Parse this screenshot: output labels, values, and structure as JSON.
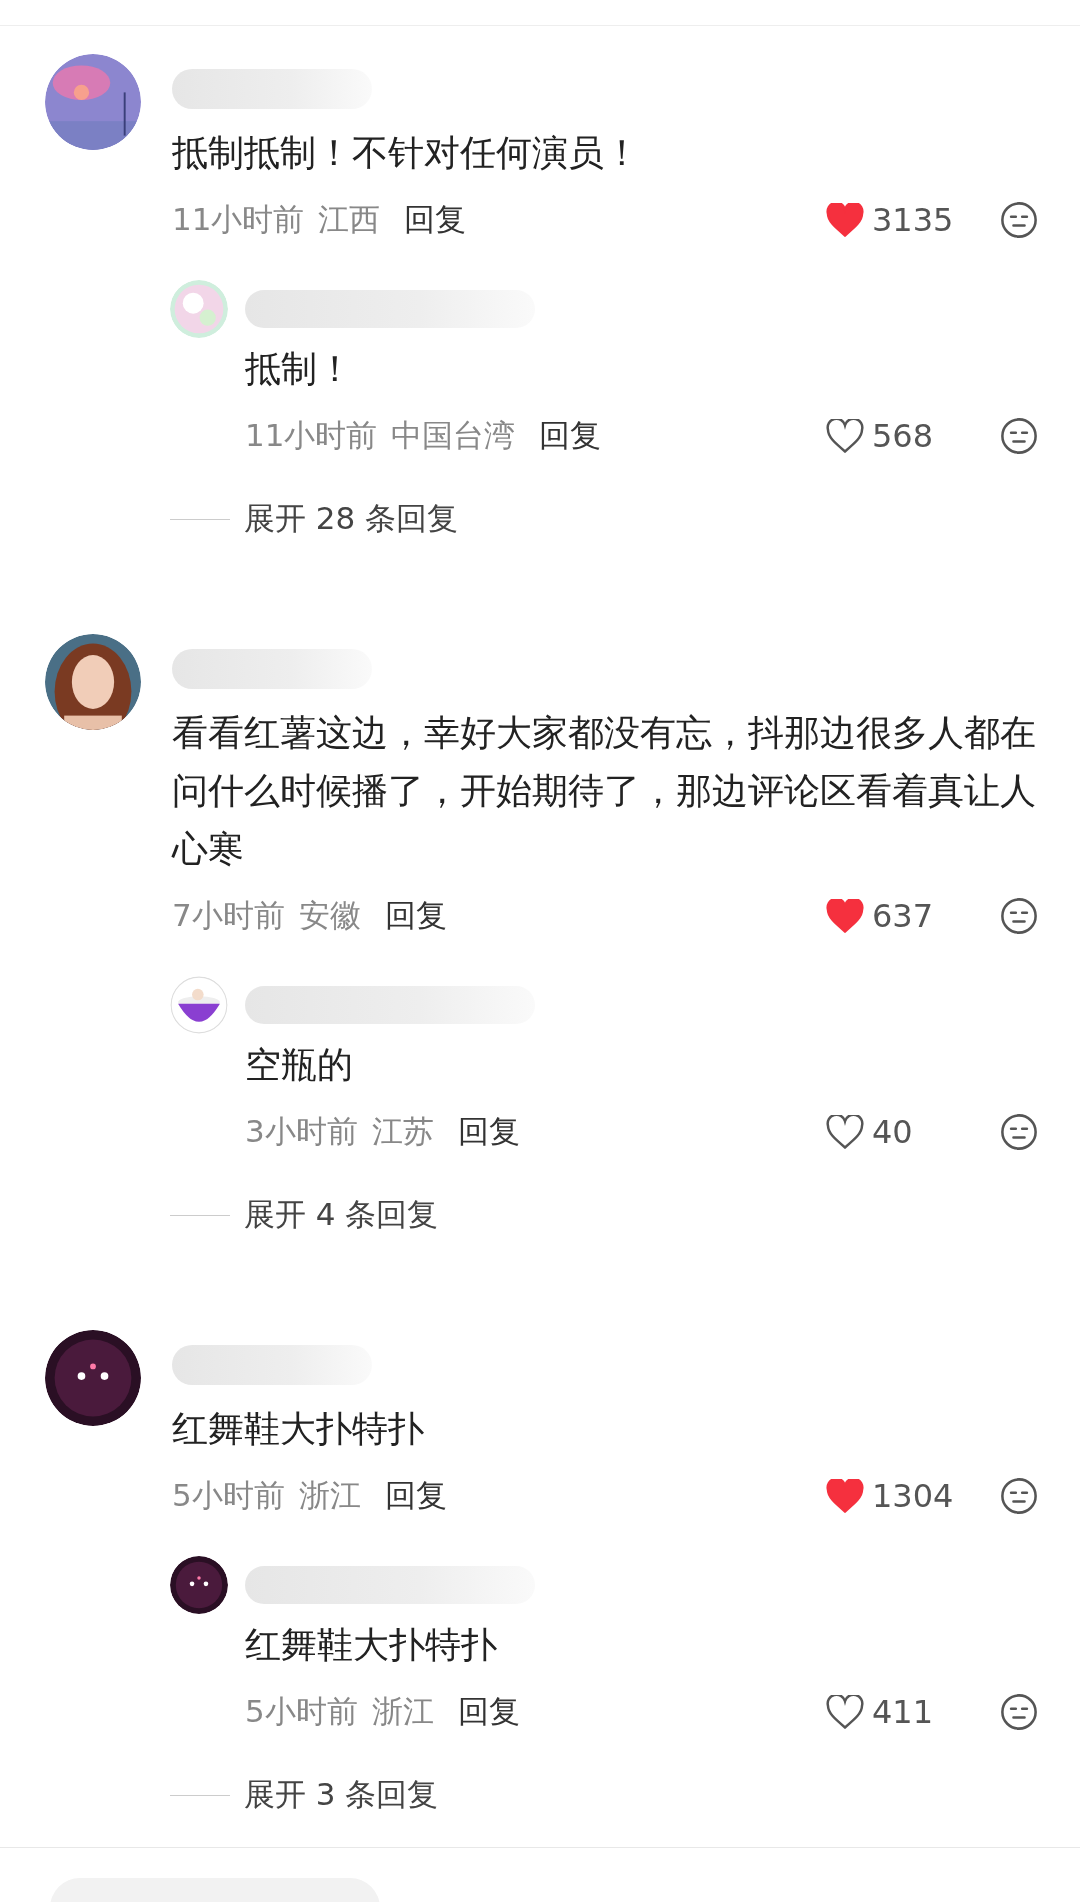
{
  "comments": [
    {
      "text": "抵制抵制！不针对任何演员！",
      "time": "11小时前",
      "location": "江西",
      "reply_label": "回复",
      "likes": "3135",
      "liked": true,
      "replies": [
        {
          "text": "抵制！",
          "time": "11小时前",
          "location": "中国台湾",
          "reply_label": "回复",
          "likes": "568",
          "liked": false
        }
      ],
      "expand": "展开 28 条回复"
    },
    {
      "text": "看看红薯这边，幸好大家都没有忘，抖那边很多人都在问什么时候播了，开始期待了，那边评论区看着真让人心寒",
      "time": "7小时前",
      "location": "安徽",
      "reply_label": "回复",
      "likes": "637",
      "liked": true,
      "replies": [
        {
          "text": "空瓶的",
          "time": "3小时前",
          "location": "江苏",
          "reply_label": "回复",
          "likes": "40",
          "liked": false
        }
      ],
      "expand": "展开 4 条回复"
    },
    {
      "text": "红舞鞋大扑特扑",
      "time": "5小时前",
      "location": "浙江",
      "reply_label": "回复",
      "likes": "1304",
      "liked": true,
      "replies": [
        {
          "text": "红舞鞋大扑特扑",
          "time": "5小时前",
          "location": "浙江",
          "reply_label": "回复",
          "likes": "411",
          "liked": false
        }
      ],
      "expand": "展开 3 条回复"
    }
  ]
}
